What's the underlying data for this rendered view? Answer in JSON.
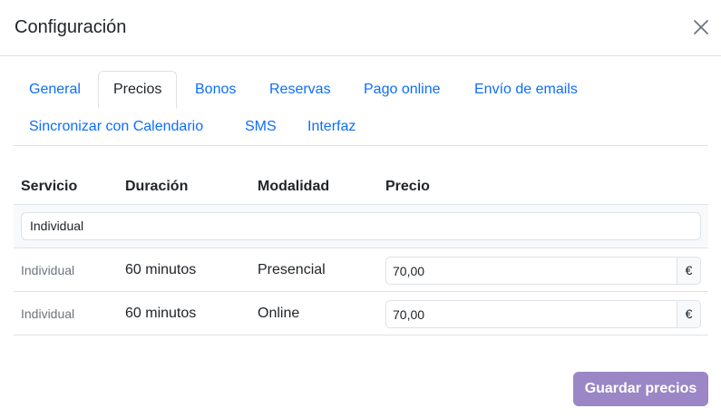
{
  "modal": {
    "title": "Configuración"
  },
  "tabs": [
    {
      "label": "General",
      "active": false
    },
    {
      "label": "Precios",
      "active": true
    },
    {
      "label": "Bonos",
      "active": false
    },
    {
      "label": "Reservas",
      "active": false
    },
    {
      "label": "Pago online",
      "active": false
    },
    {
      "label": "Envío de emails",
      "active": false
    },
    {
      "label": "Sincronizar con Calendario",
      "active": false
    },
    {
      "label": "SMS",
      "active": false
    },
    {
      "label": "Interfaz",
      "active": false
    }
  ],
  "table": {
    "headers": [
      "Servicio",
      "Duración",
      "Modalidad",
      "Precio"
    ],
    "group": "Individual",
    "rows": [
      {
        "service": "Individual",
        "duration": "60 minutos",
        "mode": "Presencial",
        "price": "70,00",
        "currency": "€"
      },
      {
        "service": "Individual",
        "duration": "60 minutos",
        "mode": "Online",
        "price": "70,00",
        "currency": "€"
      }
    ]
  },
  "actions": {
    "save_label": "Guardar precios"
  },
  "colors": {
    "link": "#0d6efd",
    "primary_button": "#9b86c6",
    "border": "#dee2e6"
  }
}
